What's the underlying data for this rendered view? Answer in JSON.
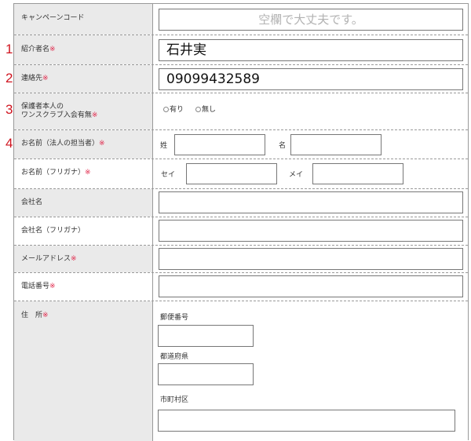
{
  "campaign_code": {
    "label": "キャンペーンコード",
    "placeholder": "空欄で大丈夫です。"
  },
  "referrer": {
    "step": "1",
    "label": "紹介者名",
    "req": "※",
    "value": "石井実"
  },
  "contact": {
    "step": "2",
    "label": "連絡先",
    "req": "※",
    "value": "09099432589"
  },
  "membership": {
    "step": "3",
    "label_line1": "保護者本人の",
    "label_line2": "ワンスクラブ入会有無",
    "req": "※",
    "option_yes": "有り",
    "option_no": "無し"
  },
  "name": {
    "step": "4",
    "label": "お名前（法人の担当者）",
    "req": "※",
    "last_label": "姓",
    "first_label": "名"
  },
  "name_kana": {
    "label": "お名前（フリガナ）",
    "req": "※",
    "last_label": "セイ",
    "first_label": "メイ"
  },
  "company": {
    "label": "会社名"
  },
  "company_kana": {
    "label": "会社名（フリガナ）"
  },
  "email": {
    "label": "メールアドレス",
    "req": "※"
  },
  "phone": {
    "label": "電話番号",
    "req": "※"
  },
  "address": {
    "label": "住　所",
    "req": "※",
    "postal_label": "郵便番号",
    "prefecture_label": "都道府県",
    "city_label": "市町村区"
  }
}
